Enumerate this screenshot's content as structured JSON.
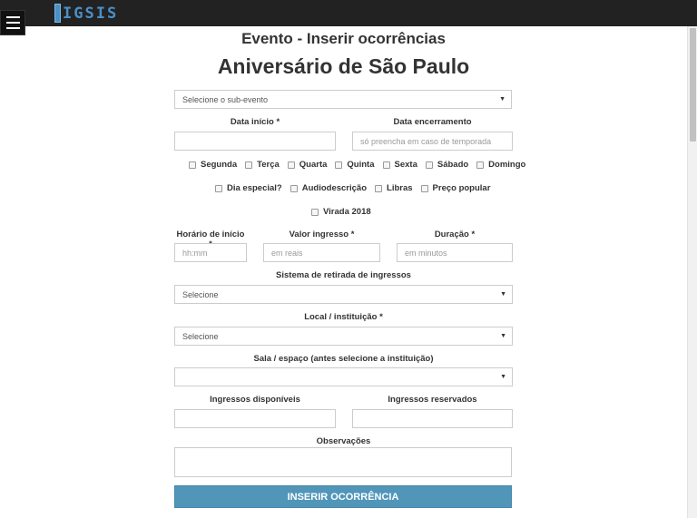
{
  "app": {
    "logo_text": "IGSIS"
  },
  "header": {
    "title": "Evento - Inserir ocorrências",
    "event_name": "Aniversário de São Paulo"
  },
  "form": {
    "subevent": {
      "value": "Selecione o sub-evento"
    },
    "start_date": {
      "label": "Data início *",
      "value": ""
    },
    "end_date": {
      "label": "Data encerramento",
      "placeholder": "só preencha em caso de temporada"
    },
    "weekdays": [
      "Segunda",
      "Terça",
      "Quarta",
      "Quinta",
      "Sexta",
      "Sábado",
      "Domingo"
    ],
    "extras": [
      "Dia especial?",
      "Audiodescrição",
      "Libras",
      "Preço popular"
    ],
    "virada": "Virada 2018",
    "start_time": {
      "label": "Horário de início *",
      "placeholder": "hh:mm"
    },
    "price": {
      "label": "Valor ingresso *",
      "placeholder": "em reais"
    },
    "duration": {
      "label": "Duração *",
      "placeholder": "em minutos"
    },
    "ticket_system": {
      "label": "Sistema de retirada de ingressos",
      "value": "Selecione"
    },
    "venue": {
      "label": "Local / instituição *",
      "value": "Selecione"
    },
    "room": {
      "label": "Sala / espaço (antes selecione a instituição)",
      "value": ""
    },
    "tickets_available": {
      "label": "Ingressos disponíveis",
      "value": ""
    },
    "tickets_reserved": {
      "label": "Ingressos reservados",
      "value": ""
    },
    "notes": {
      "label": "Observações",
      "value": ""
    },
    "submit_label": "INSERIR OCORRÊNCIA"
  },
  "icons": {
    "menu": "hamburger-icon",
    "dropdown": "caret-down-icon"
  },
  "colors": {
    "topbar": "#222222",
    "accent": "#5196b9",
    "logo": "#4a90c8"
  }
}
